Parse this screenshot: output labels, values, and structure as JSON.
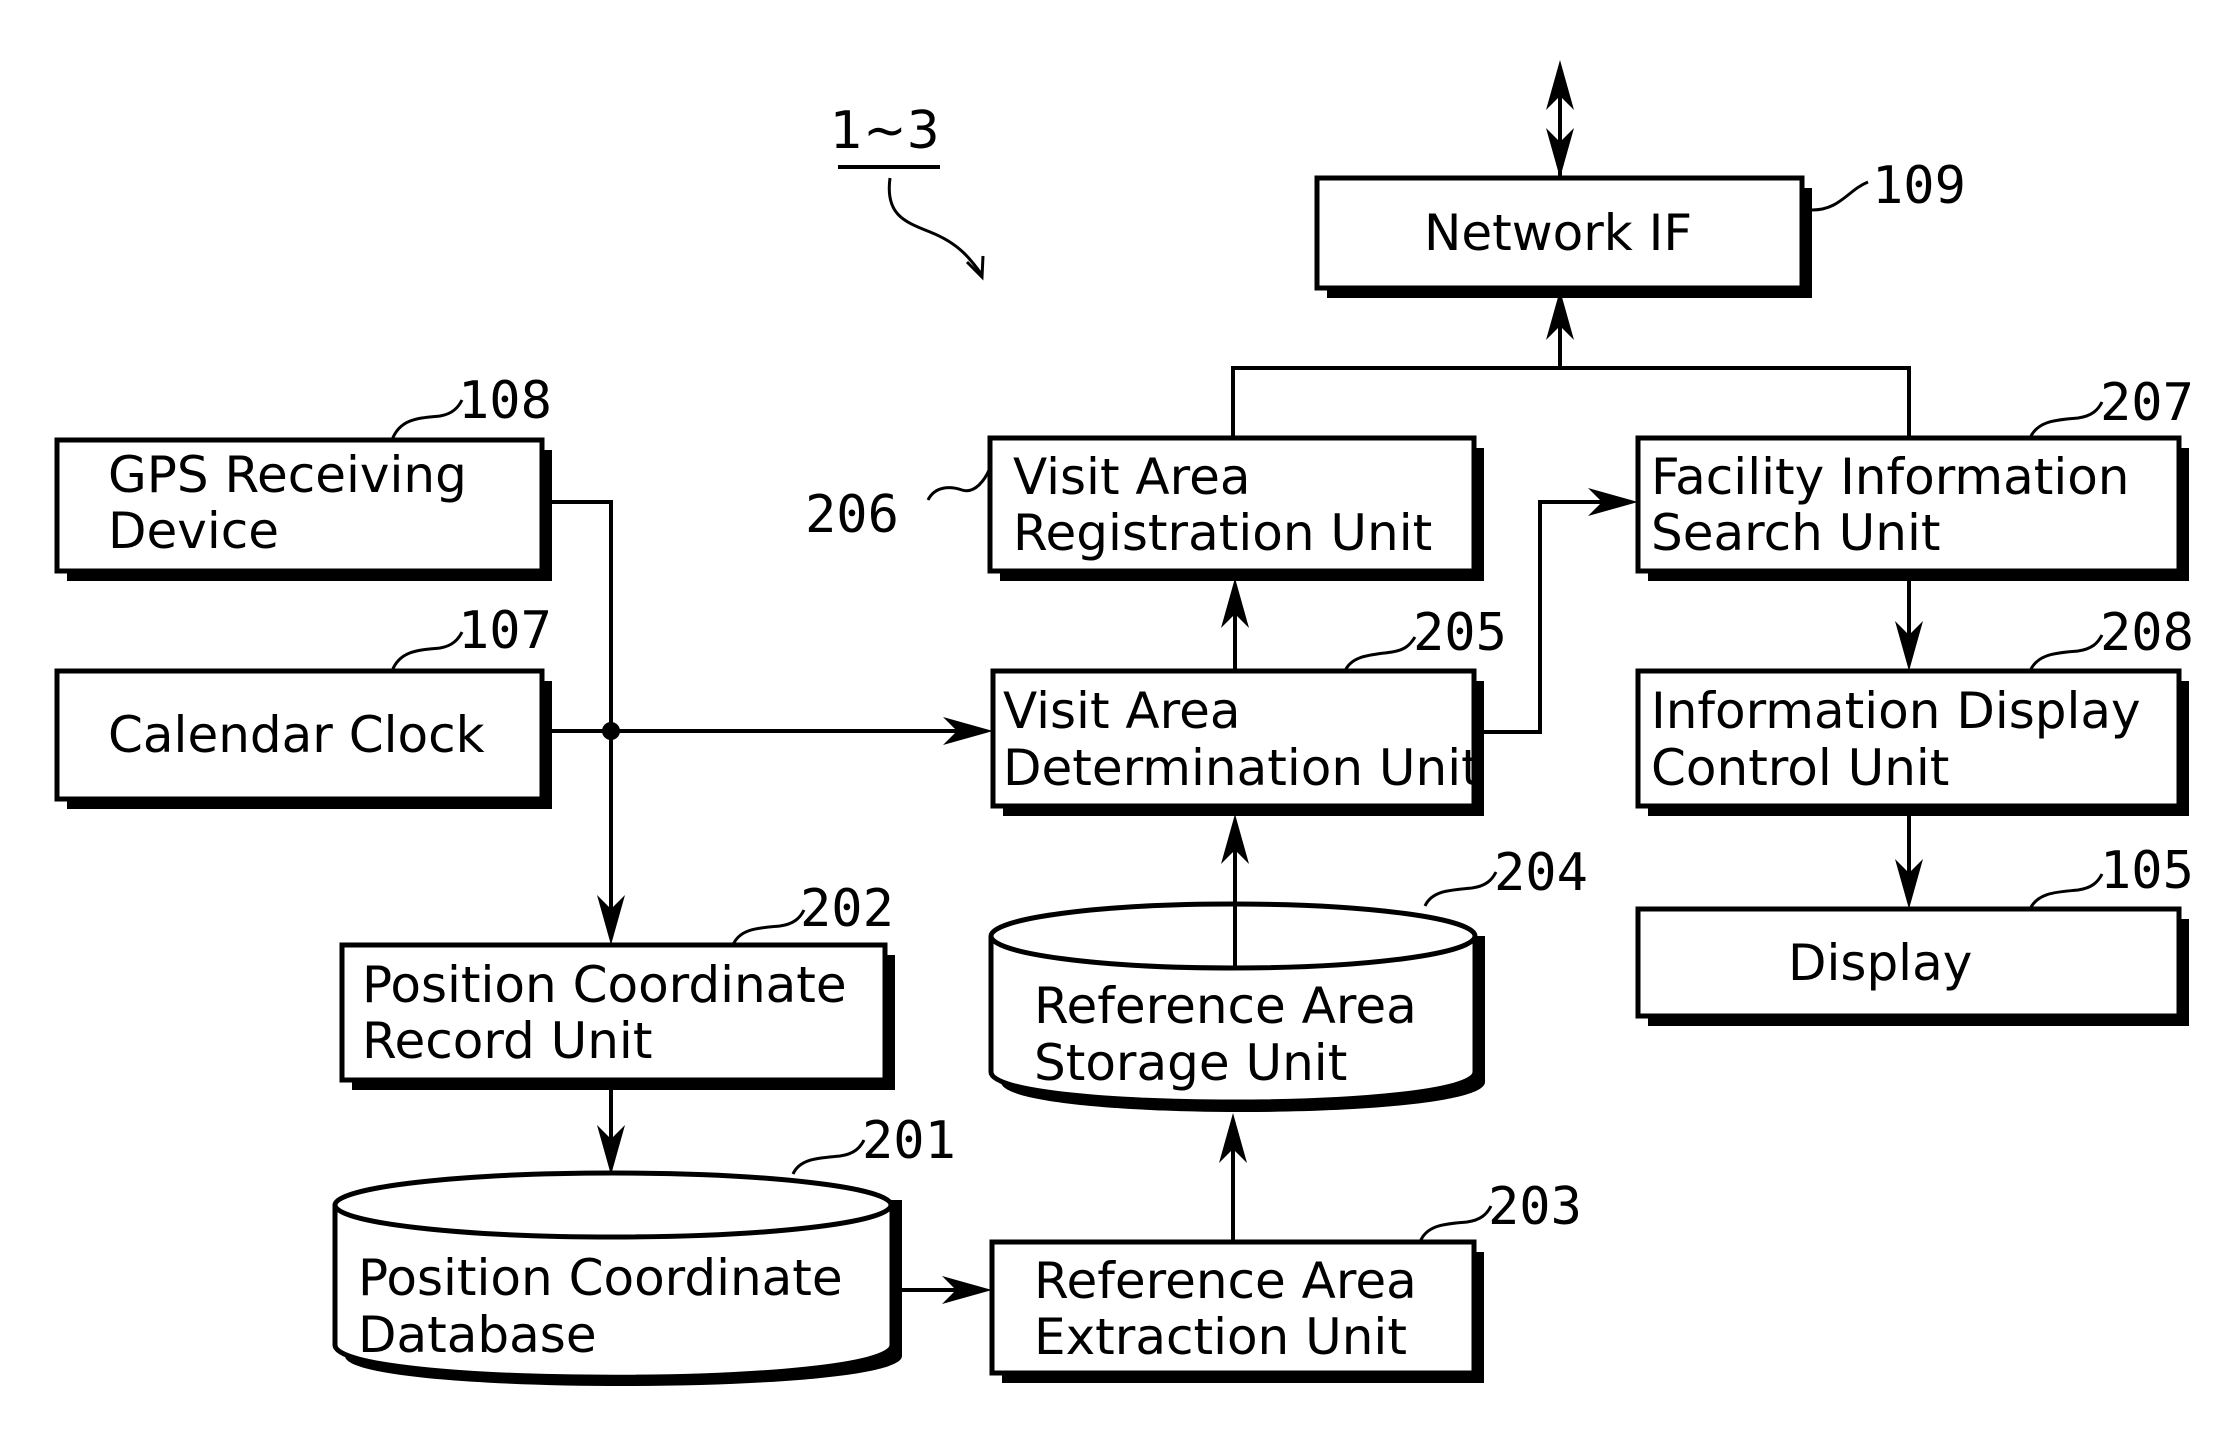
{
  "figure": {
    "system_label": "1~3"
  },
  "blocks": {
    "network_if": {
      "ref": "109",
      "lines": [
        "Network IF"
      ]
    },
    "gps": {
      "ref": "108",
      "lines": [
        "GPS Receiving",
        "Device"
      ]
    },
    "calendar_clock": {
      "ref": "107",
      "lines": [
        "Calendar Clock"
      ]
    },
    "visit_area_registration": {
      "ref": "206",
      "lines": [
        "Visit Area",
        "Registration Unit"
      ]
    },
    "visit_area_determination": {
      "ref": "205",
      "lines": [
        "Visit Area",
        "Determination Unit"
      ]
    },
    "facility_search": {
      "ref": "207",
      "lines": [
        "Facility Information",
        "Search Unit"
      ]
    },
    "info_display_control": {
      "ref": "208",
      "lines": [
        "Information Display",
        "Control Unit"
      ]
    },
    "display": {
      "ref": "105",
      "lines": [
        "Display"
      ]
    },
    "position_record": {
      "ref": "202",
      "lines": [
        "Position Coordinate",
        "Record Unit"
      ]
    },
    "position_database": {
      "ref": "201",
      "lines": [
        "Position Coordinate",
        "Database"
      ]
    },
    "reference_storage": {
      "ref": "204",
      "lines": [
        "Reference Area",
        "Storage Unit"
      ]
    },
    "reference_extraction": {
      "ref": "203",
      "lines": [
        "Reference Area",
        "Extraction Unit"
      ]
    }
  },
  "connections": [
    {
      "from": "external",
      "to": "network_if",
      "type": "bidirectional"
    },
    {
      "from": "visit_area_registration",
      "to": "network_if",
      "type": "merge"
    },
    {
      "from": "facility_search",
      "to": "network_if",
      "type": "merge"
    },
    {
      "from": "gps",
      "to": "position_record"
    },
    {
      "from": "gps",
      "to": "visit_area_determination"
    },
    {
      "from": "calendar_clock",
      "to": "visit_area_determination"
    },
    {
      "from": "calendar_clock",
      "to": "position_record"
    },
    {
      "from": "position_record",
      "to": "position_database"
    },
    {
      "from": "position_database",
      "to": "reference_extraction"
    },
    {
      "from": "reference_extraction",
      "to": "reference_storage"
    },
    {
      "from": "reference_storage",
      "to": "visit_area_determination"
    },
    {
      "from": "visit_area_determination",
      "to": "visit_area_registration"
    },
    {
      "from": "visit_area_determination",
      "to": "facility_search"
    },
    {
      "from": "facility_search",
      "to": "info_display_control"
    },
    {
      "from": "info_display_control",
      "to": "display"
    }
  ],
  "colors": {
    "ink": "#000000",
    "paper": "#ffffff"
  }
}
